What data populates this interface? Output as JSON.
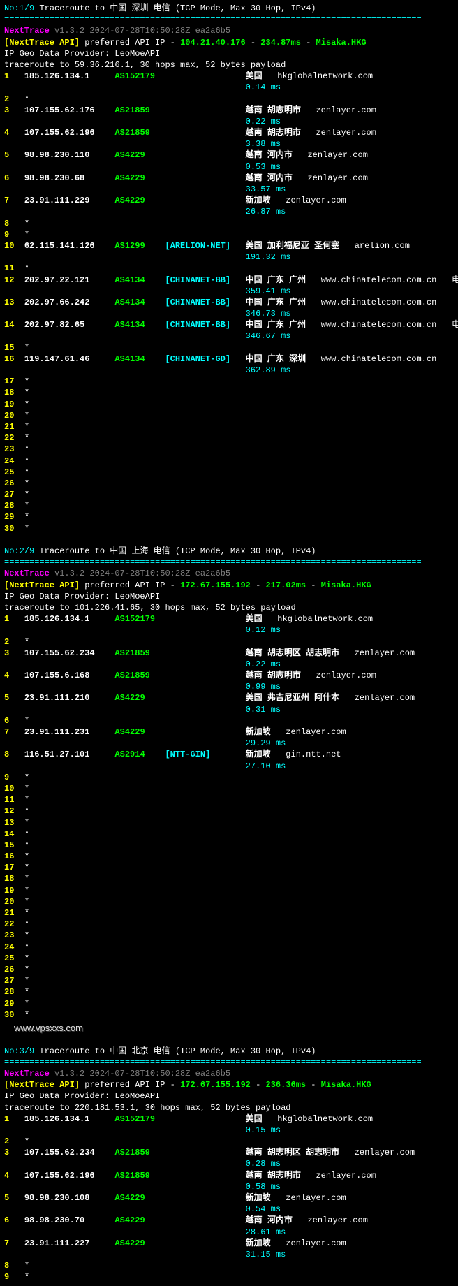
{
  "separator": "===================================================================================",
  "watermark": "www.vpsxxs.com",
  "traces": [
    {
      "title_no": "No:1/9",
      "title_text": " Traceroute to 中国 深圳 电信 (TCP Mode, Max 30 Hop, IPv4)",
      "version": "NextTrace v1.3.2 2024-07-28T10:50:28Z ea2a6b5",
      "api_prefix": "[NextTrace API]",
      "api_text": " preferred API IP - ",
      "api_ip": "104.21.40.176",
      "api_dash": " - ",
      "api_ms": "234.87ms",
      "api_dash2": " - ",
      "api_loc": "Misaka.HKG",
      "provider": "IP Geo Data Provider: LeoMoeAPI",
      "target": "traceroute to 59.36.216.1, 30 hops max, 52 bytes payload",
      "hops": [
        {
          "n": "1",
          "ip": "185.126.134.1",
          "asn": "AS152179",
          "net": "",
          "loc": "美国",
          "dom": "hkglobalnetwork.com",
          "ms": "0.14 ms",
          "ext": ""
        },
        {
          "n": "2",
          "ip": "*",
          "asn": "",
          "net": "",
          "loc": "",
          "dom": "",
          "ms": ""
        },
        {
          "n": "3",
          "ip": "107.155.62.176",
          "asn": "AS21859",
          "net": "",
          "loc": "越南 胡志明市",
          "dom": "zenlayer.com",
          "ms": "0.22 ms",
          "ext": ""
        },
        {
          "n": "4",
          "ip": "107.155.62.196",
          "asn": "AS21859",
          "net": "",
          "loc": "越南 胡志明市",
          "dom": "zenlayer.com",
          "ms": "3.38 ms",
          "ext": ""
        },
        {
          "n": "5",
          "ip": "98.98.230.110",
          "asn": "AS4229",
          "net": "",
          "loc": "越南 河内市",
          "dom": "zenlayer.com",
          "ms": "0.53 ms",
          "ext": ""
        },
        {
          "n": "6",
          "ip": "98.98.230.68",
          "asn": "AS4229",
          "net": "",
          "loc": "越南 河内市",
          "dom": "zenlayer.com",
          "ms": "33.57 ms",
          "ext": ""
        },
        {
          "n": "7",
          "ip": "23.91.111.229",
          "asn": "AS4229",
          "net": "",
          "loc": "新加坡",
          "dom": "zenlayer.com",
          "ms": "26.87 ms",
          "ext": ""
        },
        {
          "n": "8",
          "ip": "*",
          "asn": "",
          "net": "",
          "loc": "",
          "dom": "",
          "ms": ""
        },
        {
          "n": "9",
          "ip": "*",
          "asn": "",
          "net": "",
          "loc": "",
          "dom": "",
          "ms": ""
        },
        {
          "n": "10",
          "ip": "62.115.141.126",
          "asn": "AS1299",
          "net": "[ARELION-NET]",
          "loc": "美国 加利福尼亚 圣何塞",
          "dom": "arelion.com",
          "ms": "191.32 ms",
          "ext": ""
        },
        {
          "n": "11",
          "ip": "*",
          "asn": "",
          "net": "",
          "loc": "",
          "dom": "",
          "ms": ""
        },
        {
          "n": "12",
          "ip": "202.97.22.121",
          "asn": "AS4134",
          "net": "[CHINANET-BB]",
          "loc": "中国 广东 广州",
          "dom": "www.chinatelecom.com.cn",
          "ms": "359.41 ms",
          "ext": "电信"
        },
        {
          "n": "13",
          "ip": "202.97.66.242",
          "asn": "AS4134",
          "net": "[CHINANET-BB]",
          "loc": "中国 广东 广州",
          "dom": "www.chinatelecom.com.cn",
          "ms": "346.73 ms",
          "ext": ""
        },
        {
          "n": "14",
          "ip": "202.97.82.65",
          "asn": "AS4134",
          "net": "[CHINANET-BB]",
          "loc": "中国 广东 广州",
          "dom": "www.chinatelecom.com.cn",
          "ms": "346.67 ms",
          "ext": "电信"
        },
        {
          "n": "15",
          "ip": "*",
          "asn": "",
          "net": "",
          "loc": "",
          "dom": "",
          "ms": ""
        },
        {
          "n": "16",
          "ip": "119.147.61.46",
          "asn": "AS4134",
          "net": "[CHINANET-GD]",
          "loc": "中国 广东 深圳",
          "dom": "www.chinatelecom.com.cn",
          "ms": "362.89 ms",
          "ext": ""
        },
        {
          "n": "17",
          "ip": "*"
        },
        {
          "n": "18",
          "ip": "*"
        },
        {
          "n": "19",
          "ip": "*"
        },
        {
          "n": "20",
          "ip": "*"
        },
        {
          "n": "21",
          "ip": "*"
        },
        {
          "n": "22",
          "ip": "*"
        },
        {
          "n": "23",
          "ip": "*"
        },
        {
          "n": "24",
          "ip": "*"
        },
        {
          "n": "25",
          "ip": "*"
        },
        {
          "n": "26",
          "ip": "*"
        },
        {
          "n": "27",
          "ip": "*"
        },
        {
          "n": "28",
          "ip": "*"
        },
        {
          "n": "29",
          "ip": "*"
        },
        {
          "n": "30",
          "ip": "*"
        }
      ]
    },
    {
      "title_no": "No:2/9",
      "title_text": " Traceroute to 中国 上海 电信 (TCP Mode, Max 30 Hop, IPv4)",
      "version": "NextTrace v1.3.2 2024-07-28T10:50:28Z ea2a6b5",
      "api_prefix": "[NextTrace API]",
      "api_text": " preferred API IP - ",
      "api_ip": "172.67.155.192",
      "api_dash": " - ",
      "api_ms": "217.02ms",
      "api_dash2": " - ",
      "api_loc": "Misaka.HKG",
      "provider": "IP Geo Data Provider: LeoMoeAPI",
      "target": "traceroute to 101.226.41.65, 30 hops max, 52 bytes payload",
      "hops": [
        {
          "n": "1",
          "ip": "185.126.134.1",
          "asn": "AS152179",
          "net": "",
          "loc": "美国",
          "dom": "hkglobalnetwork.com",
          "ms": "0.12 ms",
          "ext": ""
        },
        {
          "n": "2",
          "ip": "*"
        },
        {
          "n": "3",
          "ip": "107.155.62.234",
          "asn": "AS21859",
          "net": "",
          "loc": "越南 胡志明区 胡志明市",
          "dom": "zenlayer.com",
          "ms": "0.22 ms",
          "ext": ""
        },
        {
          "n": "4",
          "ip": "107.155.6.168",
          "asn": "AS21859",
          "net": "",
          "loc": "越南 胡志明市",
          "dom": "zenlayer.com",
          "ms": "0.99 ms",
          "ext": ""
        },
        {
          "n": "5",
          "ip": "23.91.111.210",
          "asn": "AS4229",
          "net": "",
          "loc": "美国 弗吉尼亚州 阿什本",
          "dom": "zenlayer.com",
          "ms": "0.31 ms",
          "ext": ""
        },
        {
          "n": "6",
          "ip": "*"
        },
        {
          "n": "7",
          "ip": "23.91.111.231",
          "asn": "AS4229",
          "net": "",
          "loc": "新加坡",
          "dom": "zenlayer.com",
          "ms": "29.29 ms",
          "ext": ""
        },
        {
          "n": "8",
          "ip": "116.51.27.101",
          "asn": "AS2914",
          "net": "[NTT-GIN]",
          "loc": "新加坡",
          "dom": "gin.ntt.net",
          "ms": "27.10 ms",
          "ext": ""
        },
        {
          "n": "9",
          "ip": "*"
        },
        {
          "n": "10",
          "ip": "*"
        },
        {
          "n": "11",
          "ip": "*"
        },
        {
          "n": "12",
          "ip": "*"
        },
        {
          "n": "13",
          "ip": "*"
        },
        {
          "n": "14",
          "ip": "*"
        },
        {
          "n": "15",
          "ip": "*"
        },
        {
          "n": "16",
          "ip": "*"
        },
        {
          "n": "17",
          "ip": "*"
        },
        {
          "n": "18",
          "ip": "*"
        },
        {
          "n": "19",
          "ip": "*"
        },
        {
          "n": "20",
          "ip": "*"
        },
        {
          "n": "21",
          "ip": "*"
        },
        {
          "n": "22",
          "ip": "*"
        },
        {
          "n": "23",
          "ip": "*"
        },
        {
          "n": "24",
          "ip": "*"
        },
        {
          "n": "25",
          "ip": "*"
        },
        {
          "n": "26",
          "ip": "*"
        },
        {
          "n": "27",
          "ip": "*"
        },
        {
          "n": "28",
          "ip": "*"
        },
        {
          "n": "29",
          "ip": "*"
        },
        {
          "n": "30",
          "ip": "*"
        }
      ]
    },
    {
      "title_no": "No:3/9",
      "title_text": " Traceroute to 中国 北京 电信 (TCP Mode, Max 30 Hop, IPv4)",
      "version": "NextTrace v1.3.2 2024-07-28T10:50:28Z ea2a6b5",
      "api_prefix": "[NextTrace API]",
      "api_text": " preferred API IP - ",
      "api_ip": "172.67.155.192",
      "api_dash": " - ",
      "api_ms": "236.36ms",
      "api_dash2": " - ",
      "api_loc": "Misaka.HKG",
      "provider": "IP Geo Data Provider: LeoMoeAPI",
      "target": "traceroute to 220.181.53.1, 30 hops max, 52 bytes payload",
      "hops": [
        {
          "n": "1",
          "ip": "185.126.134.1",
          "asn": "AS152179",
          "net": "",
          "loc": "美国",
          "dom": "hkglobalnetwork.com",
          "ms": "0.15 ms",
          "ext": ""
        },
        {
          "n": "2",
          "ip": "*"
        },
        {
          "n": "3",
          "ip": "107.155.62.234",
          "asn": "AS21859",
          "net": "",
          "loc": "越南 胡志明区 胡志明市",
          "dom": "zenlayer.com",
          "ms": "0.28 ms",
          "ext": ""
        },
        {
          "n": "4",
          "ip": "107.155.62.196",
          "asn": "AS21859",
          "net": "",
          "loc": "越南 胡志明市",
          "dom": "zenlayer.com",
          "ms": "0.58 ms",
          "ext": ""
        },
        {
          "n": "5",
          "ip": "98.98.230.108",
          "asn": "AS4229",
          "net": "",
          "loc": "新加坡",
          "dom": "zenlayer.com",
          "ms": "0.54 ms",
          "ext": ""
        },
        {
          "n": "6",
          "ip": "98.98.230.70",
          "asn": "AS4229",
          "net": "",
          "loc": "越南 河内市",
          "dom": "zenlayer.com",
          "ms": "28.61 ms",
          "ext": ""
        },
        {
          "n": "7",
          "ip": "23.91.111.227",
          "asn": "AS4229",
          "net": "",
          "loc": "新加坡",
          "dom": "zenlayer.com",
          "ms": "31.15 ms",
          "ext": ""
        },
        {
          "n": "8",
          "ip": "*"
        },
        {
          "n": "9",
          "ip": "*"
        }
      ]
    }
  ]
}
